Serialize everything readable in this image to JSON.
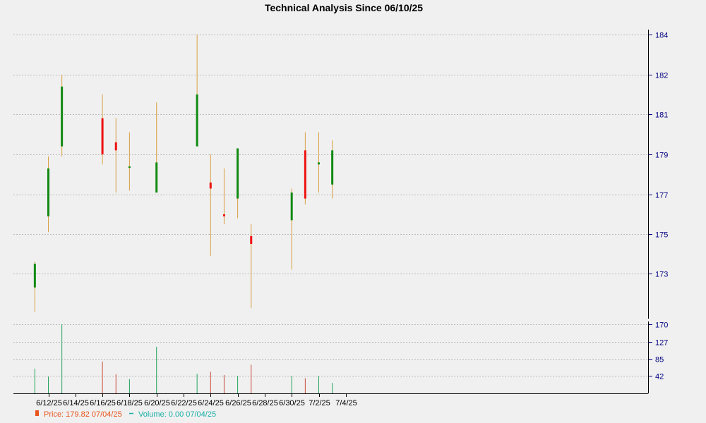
{
  "chart_data": {
    "type": "candlestick",
    "title": "Technical Analysis Since 06/10/25",
    "price_ticks": [
      173,
      175,
      177,
      179,
      181,
      182,
      184
    ],
    "volume_ticks": [
      42,
      85,
      127,
      170
    ],
    "x_ticks": [
      "6/12/25",
      "6/14/25",
      "6/16/25",
      "6/18/25",
      "6/20/25",
      "6/22/25",
      "6/24/25",
      "6/26/25",
      "6/28/25",
      "6/30/25",
      "7/2/25",
      "7/4/25"
    ],
    "price_ylim": [
      171.7,
      184.6
    ],
    "volume_ylim": [
      0,
      170
    ],
    "grid": true,
    "candles": [
      {
        "date": "6/11/25",
        "open": 172.6,
        "high": 173.6,
        "low": 171.9,
        "close": 173.5,
        "volume": 60
      },
      {
        "date": "6/12/25",
        "open": 175.9,
        "high": 178.9,
        "low": 175.1,
        "close": 178.3,
        "volume": 40
      },
      {
        "date": "6/13/25",
        "open": 179.4,
        "high": 182.0,
        "low": 178.9,
        "close": 181.7,
        "volume": 170
      },
      {
        "date": "6/16/25",
        "open": 180.8,
        "high": 181.5,
        "low": 178.5,
        "close": 179.0,
        "volume": 78
      },
      {
        "date": "6/17/25",
        "open": 179.6,
        "high": 180.8,
        "low": 177.1,
        "close": 179.2,
        "volume": 46
      },
      {
        "date": "6/18/25",
        "open": 178.4,
        "high": 180.1,
        "low": 177.2,
        "close": 178.4,
        "volume": 34
      },
      {
        "date": "6/20/25",
        "open": 177.1,
        "high": 181.3,
        "low": 177.1,
        "close": 178.6,
        "volume": 115
      },
      {
        "date": "6/23/25",
        "open": 179.4,
        "high": 184.0,
        "low": 179.4,
        "close": 181.5,
        "volume": 47
      },
      {
        "date": "6/24/25",
        "open": 177.6,
        "high": 179.0,
        "low": 173.9,
        "close": 177.3,
        "volume": 52
      },
      {
        "date": "6/25/25",
        "open": 176.0,
        "high": 178.3,
        "low": 175.5,
        "close": 175.9,
        "volume": 44
      },
      {
        "date": "6/26/25",
        "open": 176.8,
        "high": 179.3,
        "low": 175.8,
        "close": 179.3,
        "volume": 42
      },
      {
        "date": "6/27/25",
        "open": 174.9,
        "high": 175.5,
        "low": 172.0,
        "close": 174.5,
        "volume": 70
      },
      {
        "date": "6/30/25",
        "open": 175.7,
        "high": 177.3,
        "low": 173.2,
        "close": 177.1,
        "volume": 42
      },
      {
        "date": "7/1/25",
        "open": 179.2,
        "high": 180.1,
        "low": 176.5,
        "close": 176.8,
        "volume": 36
      },
      {
        "date": "7/2/25",
        "open": 178.5,
        "high": 180.1,
        "low": 177.1,
        "close": 178.6,
        "volume": 42
      },
      {
        "date": "7/3/25",
        "open": 177.5,
        "high": 179.7,
        "low": 176.8,
        "close": 179.2,
        "volume": 25
      }
    ],
    "legend": [
      {
        "icon": "price-swatch-icon",
        "label": "Price: 179.82  07/04/25",
        "color": "#e8551f"
      },
      {
        "icon": "volume-dash-icon",
        "label": "Volume: 0.00  07/04/25",
        "color": "#19b0a7"
      }
    ],
    "colors": {
      "up": "#118a11",
      "down": "#ee1111",
      "wick": "#d9a044",
      "vol_up": "#22a55d",
      "vol_down": "#cc4a3c",
      "grid": "#bbbbbb",
      "right_axis": "#000080"
    }
  }
}
